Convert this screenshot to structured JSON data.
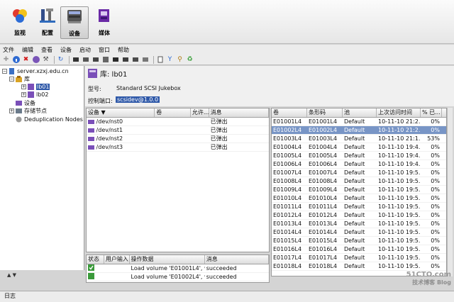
{
  "topbar": {
    "buttons": [
      {
        "label": "监视",
        "icon": "monitor-icon"
      },
      {
        "label": "配置",
        "icon": "config-icon"
      },
      {
        "label": "设备",
        "icon": "device-icon"
      },
      {
        "label": "媒体",
        "icon": "media-icon"
      }
    ],
    "active": "设备"
  },
  "menu": [
    "文件",
    "编辑",
    "查看",
    "设备",
    "启动",
    "窗口",
    "帮助"
  ],
  "tree": {
    "server": "server.xzxj.edu.cn",
    "library": "库",
    "lb01": "lb01",
    "lb02": "lb02",
    "devices": "设备",
    "storage_nodes": "存储节点",
    "dedup": "Deduplication Nodes"
  },
  "header": {
    "title": "库: lb01",
    "model_label": "型号:",
    "model_value": "Standard SCSI Jukebox",
    "control_label": "控制端口:",
    "control_value": "scsidev@1.0.0"
  },
  "devices_table": {
    "columns": [
      "设备",
      "卷",
      "允许...",
      "消息"
    ],
    "rows": [
      {
        "device": "/dev/nst0",
        "volume": "",
        "allow": "",
        "message": "已弹出"
      },
      {
        "device": "/dev/nst1",
        "volume": "",
        "allow": "",
        "message": "已弹出"
      },
      {
        "device": "/dev/nst2",
        "volume": "",
        "allow": "",
        "message": "已弹出"
      },
      {
        "device": "/dev/nst3",
        "volume": "",
        "allow": "",
        "message": "已弹出"
      }
    ]
  },
  "ops_table": {
    "columns": [
      "状态",
      "用户输入",
      "操作数据",
      "消息"
    ],
    "rows": [
      {
        "status": "ok",
        "input": "",
        "data": "Load volume 'E01001L4', v...",
        "message": "succeeded"
      },
      {
        "status": "ok",
        "input": "",
        "data": "Load volume 'E01002L4', v...",
        "message": "succeeded"
      }
    ]
  },
  "volumes_table": {
    "columns": [
      "卷",
      "条形码",
      "池",
      "上次访问时间",
      "% 已..."
    ],
    "rows": [
      {
        "vol": "E01001L4",
        "barcode": "E01001L4",
        "pool": "Default",
        "time": "10-11-10 21:2...",
        "pct": "0%"
      },
      {
        "vol": "E01002L4",
        "barcode": "E01002L4",
        "pool": "Default",
        "time": "10-11-10 21:2...",
        "pct": "0%"
      },
      {
        "vol": "E01003L4",
        "barcode": "E01003L4",
        "pool": "Default",
        "time": "10-11-10 21:1...",
        "pct": "53%"
      },
      {
        "vol": "E01004L4",
        "barcode": "E01004L4",
        "pool": "Default",
        "time": "10-11-10 19:4...",
        "pct": "0%"
      },
      {
        "vol": "E01005L4",
        "barcode": "E01005L4",
        "pool": "Default",
        "time": "10-11-10 19:4...",
        "pct": "0%"
      },
      {
        "vol": "E01006L4",
        "barcode": "E01006L4",
        "pool": "Default",
        "time": "10-11-10 19:4...",
        "pct": "0%"
      },
      {
        "vol": "E01007L4",
        "barcode": "E01007L4",
        "pool": "Default",
        "time": "10-11-10 19:5...",
        "pct": "0%"
      },
      {
        "vol": "E01008L4",
        "barcode": "E01008L4",
        "pool": "Default",
        "time": "10-11-10 19:5...",
        "pct": "0%"
      },
      {
        "vol": "E01009L4",
        "barcode": "E01009L4",
        "pool": "Default",
        "time": "10-11-10 19:5...",
        "pct": "0%"
      },
      {
        "vol": "E01010L4",
        "barcode": "E01010L4",
        "pool": "Default",
        "time": "10-11-10 19:5...",
        "pct": "0%"
      },
      {
        "vol": "E01011L4",
        "barcode": "E01011L4",
        "pool": "Default",
        "time": "10-11-10 19:5...",
        "pct": "0%"
      },
      {
        "vol": "E01012L4",
        "barcode": "E01012L4",
        "pool": "Default",
        "time": "10-11-10 19:5...",
        "pct": "0%"
      },
      {
        "vol": "E01013L4",
        "barcode": "E01013L4",
        "pool": "Default",
        "time": "10-11-10 19:5...",
        "pct": "0%"
      },
      {
        "vol": "E01014L4",
        "barcode": "E01014L4",
        "pool": "Default",
        "time": "10-11-10 19:5...",
        "pct": "0%"
      },
      {
        "vol": "E01015L4",
        "barcode": "E01015L4",
        "pool": "Default",
        "time": "10-11-10 19:5...",
        "pct": "0%"
      },
      {
        "vol": "E01016L4",
        "barcode": "E01016L4",
        "pool": "Default",
        "time": "10-11-10 19:5...",
        "pct": "0%"
      },
      {
        "vol": "E01017L4",
        "barcode": "E01017L4",
        "pool": "Default",
        "time": "10-11-10 19:5...",
        "pct": "0%"
      },
      {
        "vol": "E01018L4",
        "barcode": "E01018L4",
        "pool": "Default",
        "time": "10-11-10 19:5...",
        "pct": "0%"
      }
    ]
  },
  "statusbar": "日志",
  "watermark": {
    "line1": "51CTO.com",
    "line2": "技术博客",
    "line3": "Blog"
  },
  "colors": {
    "selection": "#2e58a8",
    "row_selected": "#7895c6"
  }
}
